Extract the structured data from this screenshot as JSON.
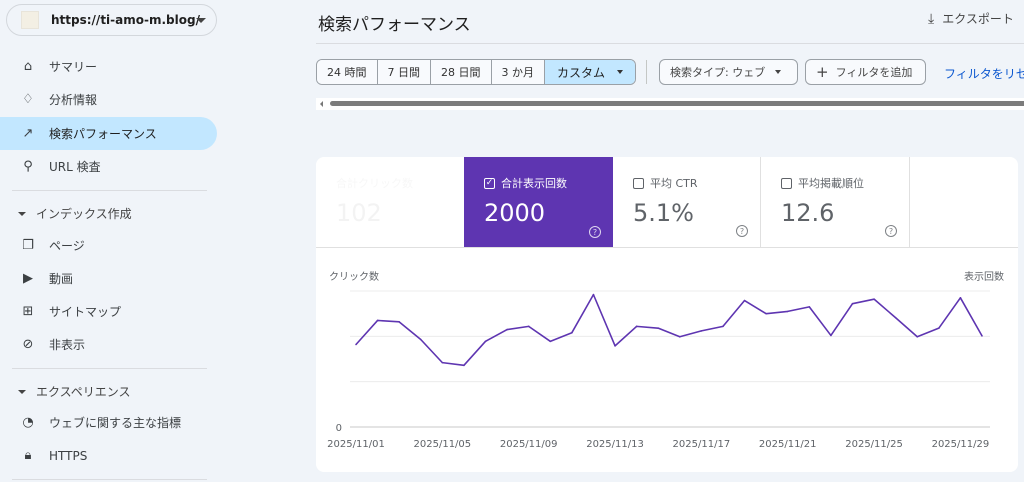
{
  "property": {
    "url": "https://ti-amo-m.blog/"
  },
  "sidebar": {
    "items": [
      {
        "label": "サマリー",
        "icon": "home-icon"
      },
      {
        "label": "分析情報",
        "icon": "lightbulb-icon"
      },
      {
        "label": "検索パフォーマンス",
        "icon": "trending-up-icon",
        "active": true
      },
      {
        "label": "URL 検査",
        "icon": "search-icon"
      }
    ],
    "section_index": {
      "label": "インデックス作成",
      "items": [
        {
          "label": "ページ",
          "icon": "pages-icon"
        },
        {
          "label": "動画",
          "icon": "video-icon"
        },
        {
          "label": "サイトマップ",
          "icon": "sitemap-icon"
        },
        {
          "label": "非表示",
          "icon": "eye-off-icon"
        }
      ]
    },
    "section_experience": {
      "label": "エクスペリエンス",
      "items": [
        {
          "label": "ウェブに関する主な指標",
          "icon": "gauge-icon"
        },
        {
          "label": "HTTPS",
          "icon": "lock-icon"
        }
      ]
    }
  },
  "header": {
    "title": "検索パフォーマンス",
    "export_label": "エクスポート"
  },
  "filters": {
    "ranges": [
      "24 時間",
      "7 日間",
      "28 日間",
      "3 か月",
      "カスタム"
    ],
    "selected_range": "カスタム",
    "search_type": "検索タイプ: ウェブ",
    "add_filter": "フィルタを追加",
    "reset": "フィルタをリセット"
  },
  "metrics": [
    {
      "label": "合計クリック数",
      "value": "102",
      "checked": false,
      "faded": true
    },
    {
      "label": "合計表示回数",
      "value": "2000",
      "checked": true
    },
    {
      "label": "平均 CTR",
      "value": "5.1%",
      "checked": false
    },
    {
      "label": "平均掲載順位",
      "value": "12.6",
      "checked": false
    }
  ],
  "colors": {
    "accent": "#5e35b1",
    "active_nav": "#c2e7ff",
    "link": "#0b57d0"
  },
  "chart_data": {
    "type": "line",
    "ylabel_left": "クリック数",
    "ylabel_right": "表示回数",
    "y_tick_labels": [
      "0"
    ],
    "ylim": [
      0,
      3
    ],
    "grid": true,
    "x_tick_labels": [
      "2025/11/01",
      "2025/11/05",
      "2025/11/09",
      "2025/11/13",
      "2025/11/17",
      "2025/11/21",
      "2025/11/25",
      "2025/11/29"
    ],
    "x": [
      "2025/11/01",
      "2025/11/02",
      "2025/11/03",
      "2025/11/04",
      "2025/11/05",
      "2025/11/06",
      "2025/11/07",
      "2025/11/08",
      "2025/11/09",
      "2025/11/10",
      "2025/11/11",
      "2025/11/12",
      "2025/11/13",
      "2025/11/14",
      "2025/11/15",
      "2025/11/16",
      "2025/11/17",
      "2025/11/18",
      "2025/11/19",
      "2025/11/20",
      "2025/11/21",
      "2025/11/22",
      "2025/11/23",
      "2025/11/24",
      "2025/11/25",
      "2025/11/26",
      "2025/11/27",
      "2025/11/28",
      "2025/11/29",
      "2025/11/30"
    ],
    "series": [
      {
        "color": "#5e35b1",
        "values": [
          1.82,
          2.35,
          2.32,
          1.93,
          1.42,
          1.36,
          1.89,
          2.15,
          2.22,
          1.89,
          2.08,
          2.92,
          1.79,
          2.22,
          2.18,
          1.99,
          2.12,
          2.22,
          2.79,
          2.5,
          2.55,
          2.65,
          2.02,
          2.72,
          2.82,
          2.41,
          1.99,
          2.18,
          2.85,
          2.01
        ]
      }
    ]
  }
}
